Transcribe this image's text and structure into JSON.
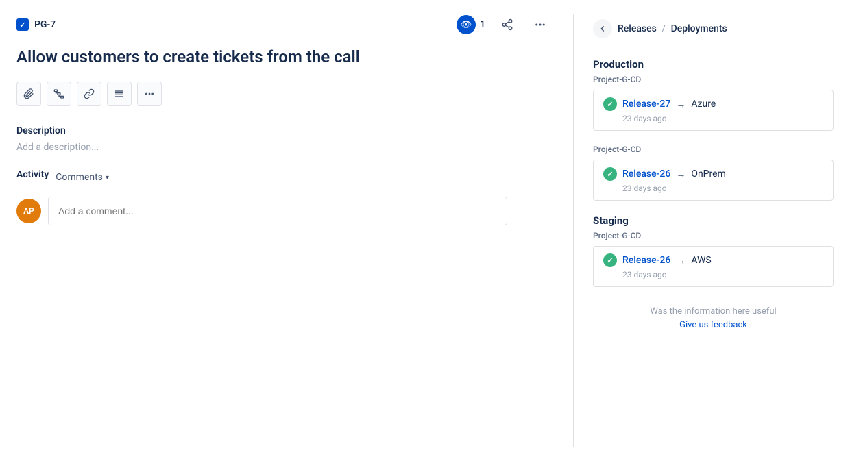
{
  "header": {
    "ticket_id": "PG-7",
    "watch_count": "1",
    "share_icon": "⋮",
    "more_icon": "⋯"
  },
  "title": "Allow customers to create tickets from the call",
  "toolbar": {
    "attachment_label": "📎",
    "hierarchy_label": "⎇",
    "link_label": "🔗",
    "details_label": "≡",
    "more_label": "•••"
  },
  "description": {
    "label": "Description",
    "placeholder": "Add a description..."
  },
  "activity": {
    "label": "Activity",
    "comments_label": "Comments",
    "avatar_initials": "AP",
    "comment_placeholder": "Add a comment..."
  },
  "side_panel": {
    "back_label": "←",
    "breadcrumb_part1": "Releases",
    "breadcrumb_sep": "/",
    "breadcrumb_part2": "Deployments",
    "sections": [
      {
        "env": "Production",
        "project": "Project-G-CD",
        "release": "Release-27",
        "arrow": "→",
        "target": "Azure",
        "time": "23 days ago"
      },
      {
        "env": null,
        "project": "Project-G-CD",
        "release": "Release-26",
        "arrow": "→",
        "target": "OnPrem",
        "time": "23 days ago"
      },
      {
        "env": "Staging",
        "project": "Project-G-CD",
        "release": "Release-26",
        "arrow": "→",
        "target": "AWS",
        "time": "23 days ago"
      }
    ],
    "feedback_text": "Was the information here useful",
    "feedback_link": "Give us feedback"
  }
}
